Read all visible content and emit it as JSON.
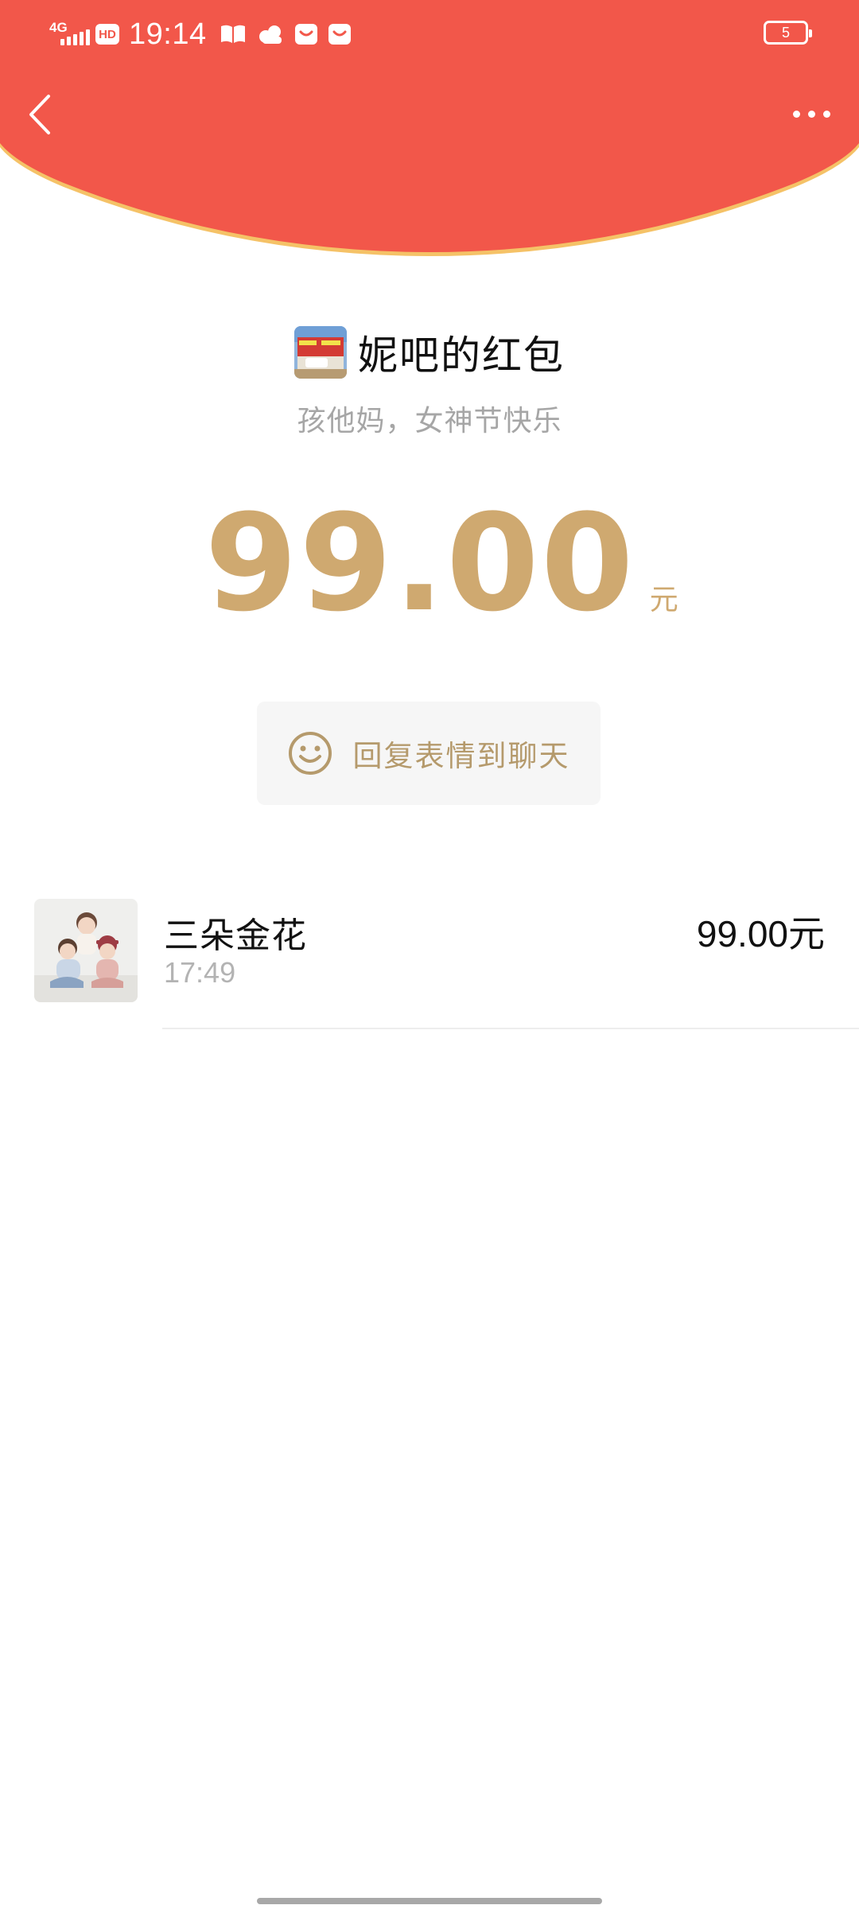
{
  "status_bar": {
    "network": "4G",
    "hd": "HD",
    "time": "19:14",
    "battery": "5",
    "icons": [
      "book-icon",
      "weather-cloud-icon",
      "mail-bag-icon",
      "mail-bag-icon"
    ]
  },
  "colors": {
    "header_red": "#f2574a",
    "header_edge": "#f5c267",
    "amount_gold": "#cfa970",
    "reply_text": "#b59a6c",
    "reply_bg": "#f6f6f6"
  },
  "envelope": {
    "sender_title": "妮吧的红包",
    "greeting": "孩他妈，女神节快乐",
    "amount": "99.00",
    "unit": "元"
  },
  "reply": {
    "label": "回复表情到聊天"
  },
  "receivers": [
    {
      "name": "三朵金花",
      "time": "17:49",
      "amount": "99.00元"
    }
  ]
}
